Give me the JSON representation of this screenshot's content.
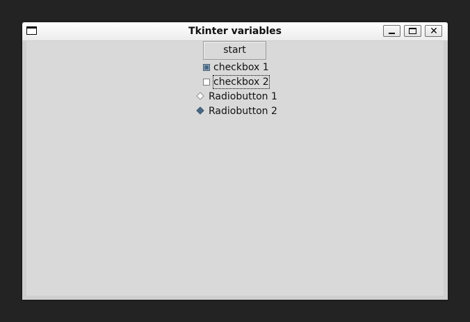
{
  "window": {
    "title": "Tkinter variables"
  },
  "buttons": {
    "start_label": "start"
  },
  "checkboxes": [
    {
      "label": "checkbox 1",
      "checked": true
    },
    {
      "label": "checkbox 2",
      "checked": false,
      "focused": true
    }
  ],
  "radiobuttons": [
    {
      "label": "Radiobutton 1",
      "selected": false
    },
    {
      "label": "Radiobutton 2",
      "selected": true
    }
  ],
  "colors": {
    "desktop": "#232323",
    "window_bg": "#d9d9d9",
    "accent": "#4a6984"
  },
  "icons": {
    "window_menu": "window-menu-icon",
    "minimize": "minimize-icon",
    "maximize": "maximize-icon",
    "close": "close-icon"
  }
}
